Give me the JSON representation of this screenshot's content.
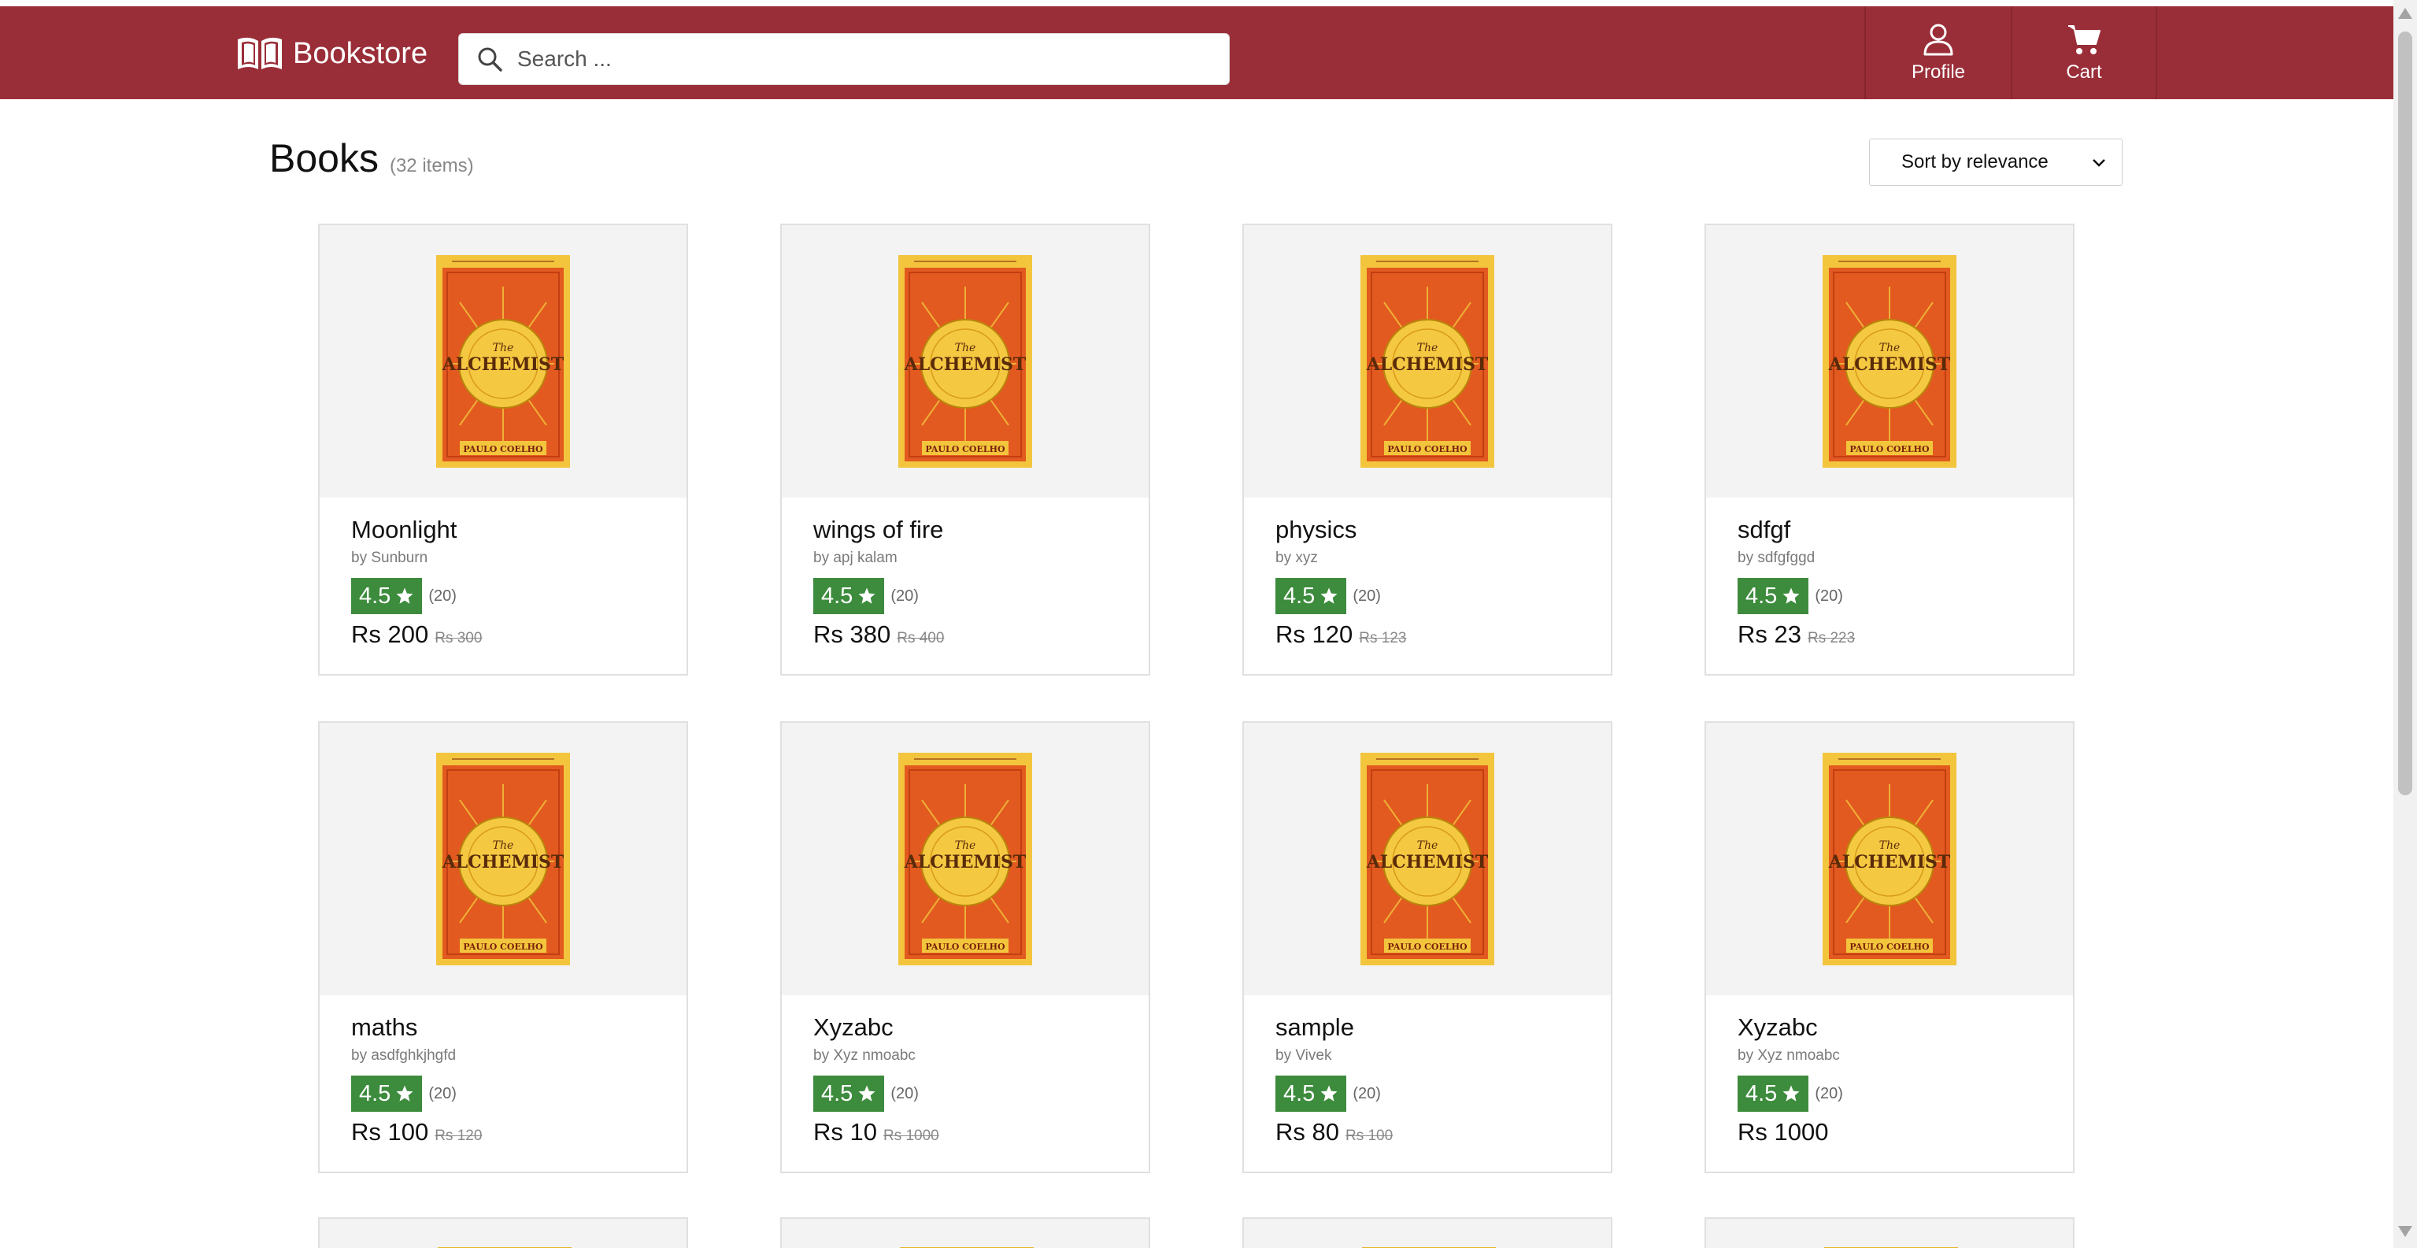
{
  "header": {
    "brand": "Bookstore",
    "search_placeholder": "Search ...",
    "nav": [
      {
        "label": "Profile",
        "icon": "user-icon"
      },
      {
        "label": "Cart",
        "icon": "cart-icon"
      }
    ]
  },
  "listing": {
    "title": "Books",
    "count": "(32 items)",
    "sort_selected": "Sort by relevance"
  },
  "colors": {
    "header_bg": "#9a2e38",
    "rating_badge": "#3d8b3d",
    "cover_orange": "#e25a1f",
    "cover_yellow": "#f2c53d"
  },
  "cover": {
    "title_top": "The",
    "title_main": "ALCHEMIST",
    "author": "PAULO COELHO"
  },
  "products": [
    {
      "title": "Moonlight",
      "author": "by Sunburn",
      "rating": "4.5",
      "count": "(20)",
      "price": "Rs 200",
      "old_price": "Rs 300"
    },
    {
      "title": "wings of fire",
      "author": "by apj kalam",
      "rating": "4.5",
      "count": "(20)",
      "price": "Rs 380",
      "old_price": "Rs 400"
    },
    {
      "title": "physics",
      "author": "by xyz",
      "rating": "4.5",
      "count": "(20)",
      "price": "Rs 120",
      "old_price": "Rs 123"
    },
    {
      "title": "sdfgf",
      "author": "by sdfgfggd",
      "rating": "4.5",
      "count": "(20)",
      "price": "Rs 23",
      "old_price": "Rs 223"
    },
    {
      "title": "maths",
      "author": "by asdfghkjhgfd",
      "rating": "4.5",
      "count": "(20)",
      "price": "Rs 100",
      "old_price": "Rs 120"
    },
    {
      "title": "Xyzabc",
      "author": "by Xyz nmoabc",
      "rating": "4.5",
      "count": "(20)",
      "price": "Rs 10",
      "old_price": "Rs 1000"
    },
    {
      "title": "sample",
      "author": "by Vivek",
      "rating": "4.5",
      "count": "(20)",
      "price": "Rs 80",
      "old_price": "Rs 100"
    },
    {
      "title": "Xyzabc",
      "author": "by Xyz nmoabc",
      "rating": "4.5",
      "count": "(20)",
      "price": "Rs 1000",
      "old_price": ""
    }
  ]
}
